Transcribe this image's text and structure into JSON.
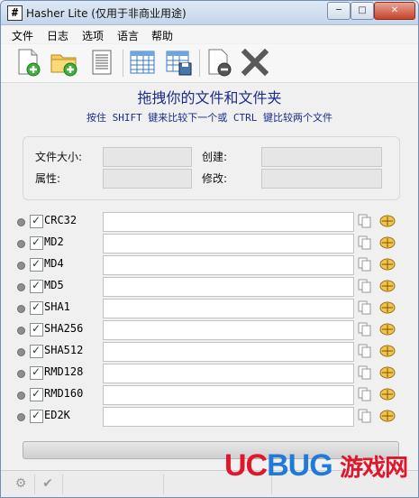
{
  "window": {
    "icon_glyph": "#",
    "title": "Hasher Lite (仅用于非商业用途)",
    "minimize_glyph": "─",
    "maximize_glyph": "□",
    "close_glyph": "✕"
  },
  "menu": [
    {
      "label": "文件"
    },
    {
      "label": "日志"
    },
    {
      "label": "选项"
    },
    {
      "label": "语言"
    },
    {
      "label": "帮助"
    }
  ],
  "toolbar": {
    "icons": [
      "add-file-icon",
      "add-folder-icon",
      "document-icon",
      "table-icon",
      "save-table-icon",
      "remove-icon",
      "delete-x-icon"
    ]
  },
  "drop": {
    "title": "拖拽你的文件和文件夹",
    "hint": "按住 SHIFT 键来比较下一个或 CTRL 键比较两个文件"
  },
  "info": {
    "size_label": "文件大小:",
    "attr_label": "属性:",
    "created_label": "创建:",
    "modified_label": "修改:"
  },
  "hashes": [
    {
      "name": "CRC32",
      "checked": true
    },
    {
      "name": "MD2",
      "checked": true
    },
    {
      "name": "MD4",
      "checked": true
    },
    {
      "name": "MD5",
      "checked": true
    },
    {
      "name": "SHA1",
      "checked": true
    },
    {
      "name": "SHA256",
      "checked": true
    },
    {
      "name": "SHA512",
      "checked": true
    },
    {
      "name": "RMD128",
      "checked": true
    },
    {
      "name": "RMD160",
      "checked": true
    },
    {
      "name": "ED2K",
      "checked": true
    }
  ],
  "progress": {
    "value": 0
  },
  "status": {
    "icons": [
      "gear-icon",
      "checkmark-icon"
    ]
  },
  "watermark": {
    "uc": "UC",
    "bug": "BUG",
    "cn": "游戏网"
  }
}
